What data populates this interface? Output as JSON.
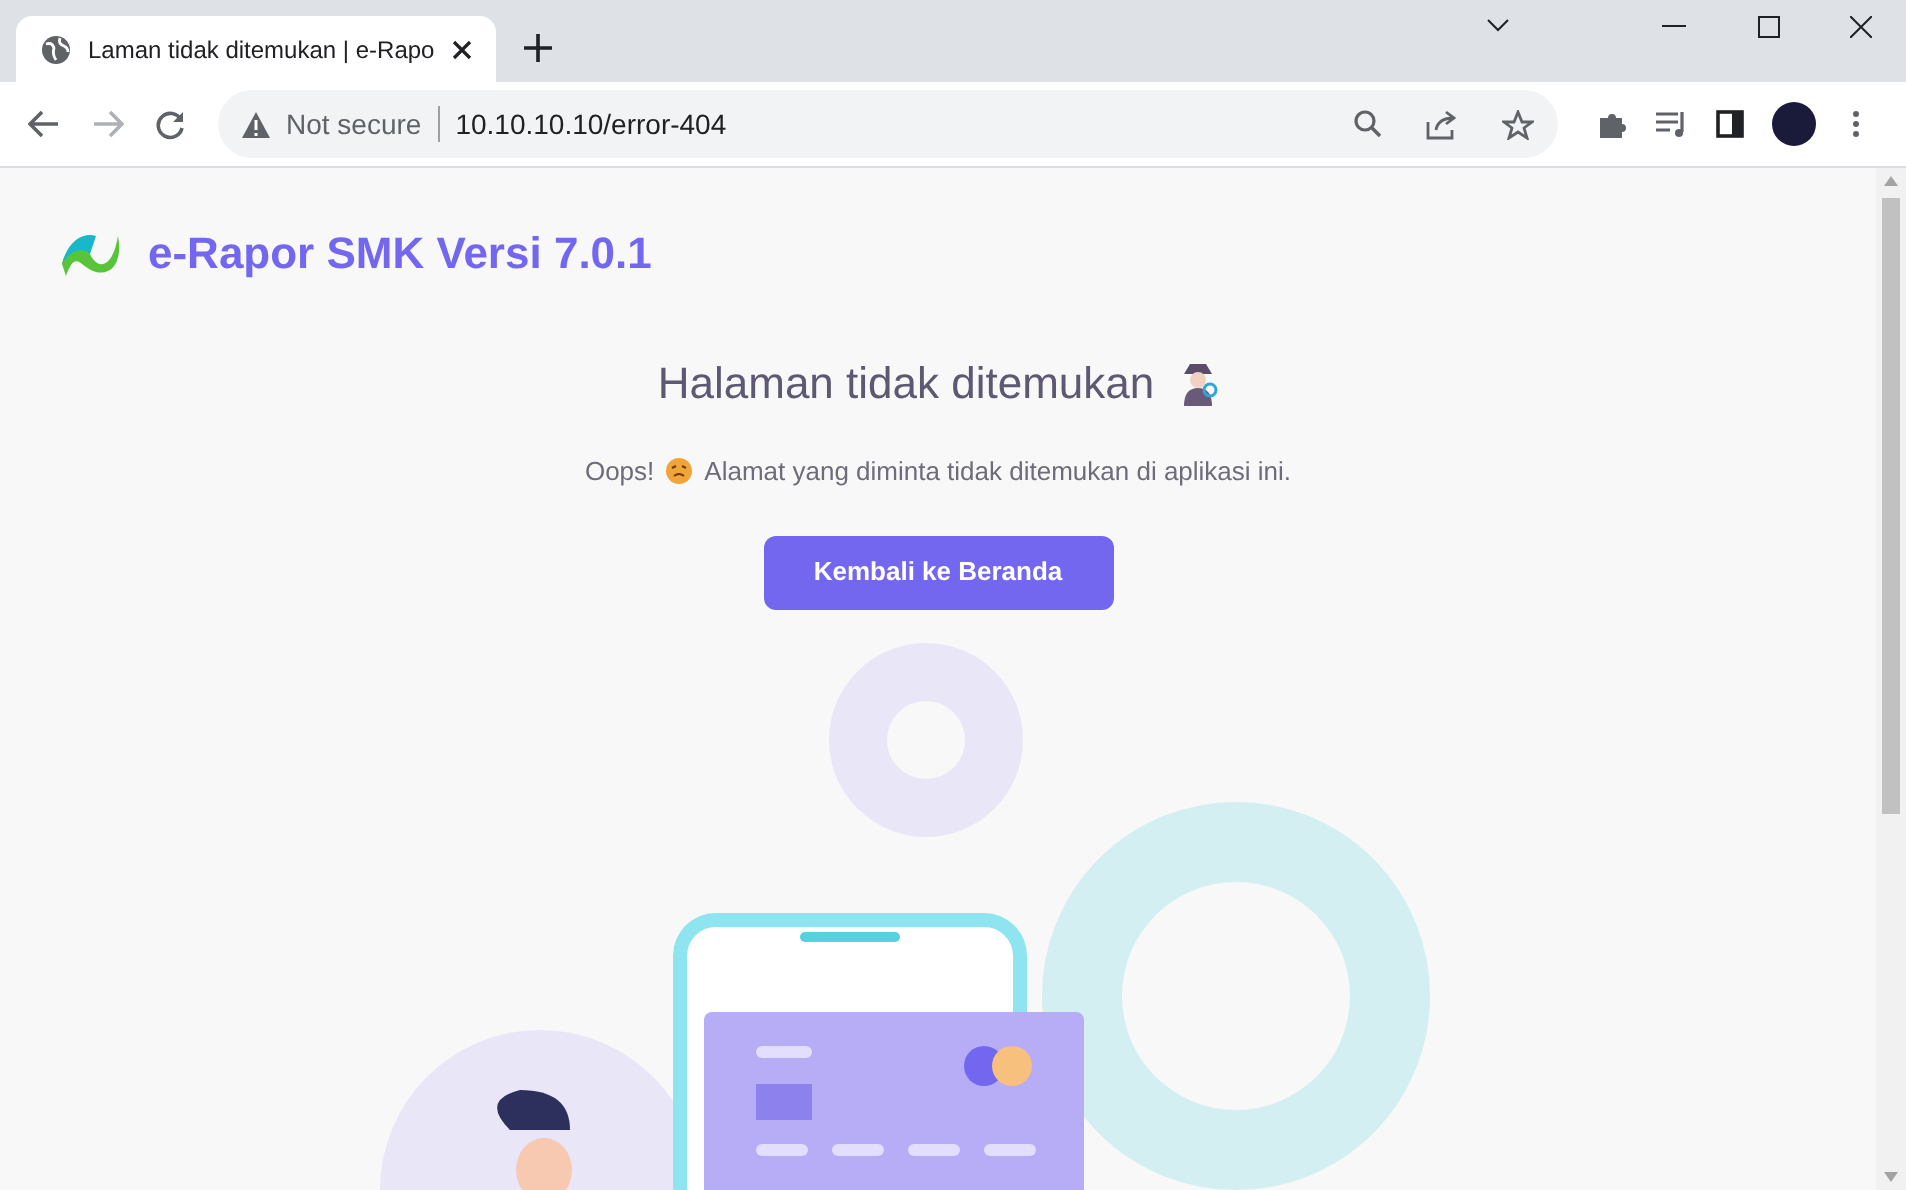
{
  "browser": {
    "tab_title": "Laman tidak ditemukan | e-Rapo",
    "security_label": "Not secure",
    "url": "10.10.10.10/error-404"
  },
  "page": {
    "brand": "e-Rapor SMK Versi 7.0.1",
    "heading": "Halaman tidak ditemukan",
    "message_lead": "Oops!",
    "message": "Alamat yang diminta tidak ditemukan di aplikasi ini.",
    "button": "Kembali ke Beranda"
  }
}
